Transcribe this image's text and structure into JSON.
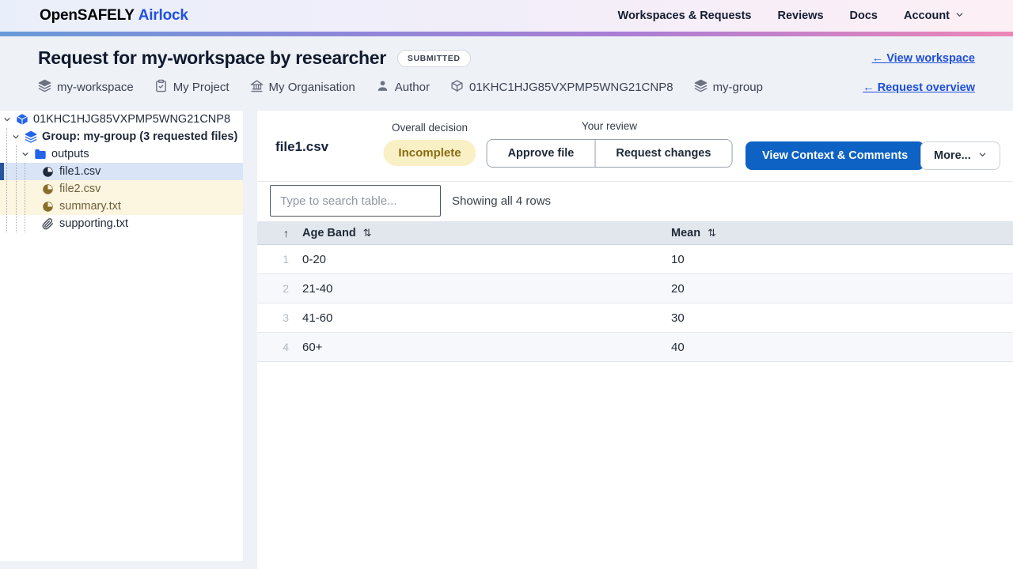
{
  "nav": {
    "brand_part1": "OpenSAFELY",
    "brand_part2": "Airlock",
    "items": [
      {
        "label": "Workspaces & Requests"
      },
      {
        "label": "Reviews"
      },
      {
        "label": "Docs"
      },
      {
        "label": "Account",
        "icon": "chevron-down-icon"
      }
    ]
  },
  "header": {
    "title": "Request for my-workspace by researcher",
    "status_badge": "SUBMITTED",
    "links": {
      "view_workspace": "← View workspace",
      "request_overview": "← Request overview"
    },
    "meta": [
      {
        "icon": "layers-icon",
        "label": "my-workspace"
      },
      {
        "icon": "clipboard-icon",
        "label": "My Project"
      },
      {
        "icon": "bank-icon",
        "label": "My Organisation"
      },
      {
        "icon": "user-icon",
        "label": "Author"
      },
      {
        "icon": "cube-icon",
        "label": "01KHC1HJG85VXPMP5WNG21CNP8"
      },
      {
        "icon": "layers-icon",
        "label": "my-group"
      }
    ]
  },
  "sidebar": {
    "tree": {
      "root_label": "01KHC1HJG85VXPMP5WNG21CNP8",
      "group_label": "Group: my-group (3 requested files)",
      "folder_label": "outputs",
      "files": [
        {
          "name": "file1.csv",
          "icon": "pie-chart-icon",
          "state": "selected"
        },
        {
          "name": "file2.csv",
          "icon": "pie-chart-icon",
          "state": "attention"
        },
        {
          "name": "summary.txt",
          "icon": "pie-chart-icon",
          "state": "attention"
        },
        {
          "name": "supporting.txt",
          "icon": "paperclip-icon",
          "state": "default"
        }
      ]
    }
  },
  "main": {
    "file_title": "file1.csv",
    "overall_decision_label": "Overall decision",
    "overall_decision_value": "Incomplete",
    "your_review_label": "Your review",
    "approve_button": "Approve file",
    "request_changes_button": "Request changes",
    "view_context_button": "View Context & Comments",
    "more_button": "More...",
    "search_placeholder": "Type to search table...",
    "rows_status": "Showing all 4 rows"
  },
  "table": {
    "columns": [
      {
        "label": "Age Band",
        "sort_icon": "sort-both-icon"
      },
      {
        "label": "Mean",
        "sort_icon": "sort-both-icon"
      }
    ],
    "rows": [
      {
        "num": "1",
        "age_band": "0-20",
        "mean": "10"
      },
      {
        "num": "2",
        "age_band": "21-40",
        "mean": "20"
      },
      {
        "num": "3",
        "age_band": "41-60",
        "mean": "30"
      },
      {
        "num": "4",
        "age_band": "60+",
        "mean": "40"
      }
    ]
  },
  "icons": {
    "sort_active": "↑",
    "sort_both": "⇅"
  },
  "colors": {
    "accent_blue": "#0d62c4",
    "link_blue": "#1d4ed8",
    "brand_navy": "#0c1b4d",
    "tree_icon_blue": "#2563eb",
    "decision_bg": "#faf0c5",
    "decision_text": "#8a6c13",
    "selected_file_bg": "#d9e5f7",
    "selected_file_bar": "#24549e",
    "attention_file_bg": "#fcf5df",
    "attention_file_text": "#6e5f3d",
    "table_header_bg": "#e2e7ee",
    "nav_gradient": [
      "#689ad8",
      "#8f87d8",
      "#ee86b7"
    ]
  }
}
